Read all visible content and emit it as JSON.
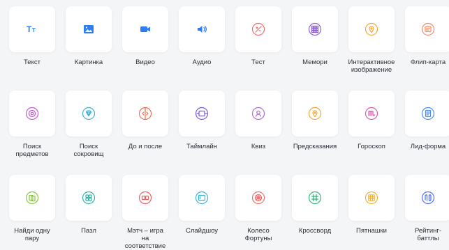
{
  "tiles": [
    {
      "label": "Текст",
      "icon": "text-icon",
      "color": "#2f7df6",
      "filled": true
    },
    {
      "label": "Картинка",
      "icon": "image-icon",
      "color": "#2f7df6",
      "filled": true
    },
    {
      "label": "Видео",
      "icon": "video-icon",
      "color": "#2f7df6",
      "filled": true
    },
    {
      "label": "Аудио",
      "icon": "audio-icon",
      "color": "#2f7df6",
      "filled": true
    },
    {
      "label": "Тест",
      "icon": "test-icon",
      "color": "#f26b6b",
      "filled": false
    },
    {
      "label": "Мемори",
      "icon": "memory-icon",
      "color": "#8a5bd6",
      "filled": false
    },
    {
      "label": "Интерактивное\nизображение",
      "icon": "interactive-image-icon",
      "color": "#f3a736",
      "filled": false
    },
    {
      "label": "Флип-карта",
      "icon": "flip-card-icon",
      "color": "#f28b6b",
      "filled": false
    },
    {
      "label": "Поиск\nпредметов",
      "icon": "find-items-icon",
      "color": "#c45bd6",
      "filled": false
    },
    {
      "label": "Поиск\nсокровищ",
      "icon": "treasure-hunt-icon",
      "color": "#3bb3d9",
      "filled": false
    },
    {
      "label": "До и после",
      "icon": "before-after-icon",
      "color": "#f26b4b",
      "filled": false
    },
    {
      "label": "Таймлайн",
      "icon": "timeline-icon",
      "color": "#7a5bd6",
      "filled": false
    },
    {
      "label": "Квиз",
      "icon": "quiz-icon",
      "color": "#b06bd6",
      "filled": false
    },
    {
      "label": "Предсказания",
      "icon": "prediction-icon",
      "color": "#f3a736",
      "filled": false
    },
    {
      "label": "Гороскоп",
      "icon": "horoscope-icon",
      "color": "#d65bb3",
      "filled": false
    },
    {
      "label": "Лид-форма",
      "icon": "lead-form-icon",
      "color": "#4b8ef2",
      "filled": false
    },
    {
      "label": "Найди одну\nпару",
      "icon": "find-pair-icon",
      "color": "#8cc63f",
      "filled": false
    },
    {
      "label": "Пазл",
      "icon": "puzzle-icon",
      "color": "#2fb3a8",
      "filled": false
    },
    {
      "label": "Мэтч – игра\nна\nсоответствие",
      "icon": "match-game-icon",
      "color": "#f25b5b",
      "filled": false
    },
    {
      "label": "Слайдшоу",
      "icon": "slideshow-icon",
      "color": "#3bb3d9",
      "filled": false
    },
    {
      "label": "Колесо\nФортуны",
      "icon": "fortune-wheel-icon",
      "color": "#f26b6b",
      "filled": false
    },
    {
      "label": "Кроссворд",
      "icon": "crossword-icon",
      "color": "#2fb37a",
      "filled": false
    },
    {
      "label": "Пятнашки",
      "icon": "fifteen-puzzle-icon",
      "color": "#f3b336",
      "filled": false
    },
    {
      "label": "Рейтинг-\nбаттлы",
      "icon": "rating-battle-icon",
      "color": "#4b6ef2",
      "filled": false
    }
  ]
}
